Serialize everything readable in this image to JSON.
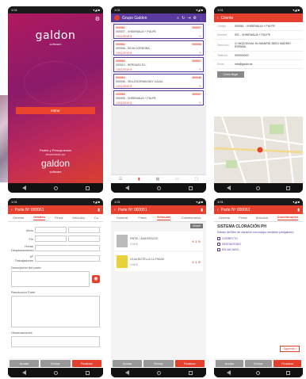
{
  "login": {
    "brand_top": "galdon",
    "brand_sub": "software",
    "login_button": "entrar",
    "footer_line1": "Partes y Presupuestos",
    "footer_line2": "desarrollado por",
    "brand_bottom": "galdon",
    "brand_bottom_sub": "software"
  },
  "list": {
    "header_title": "Grupo Galdon",
    "cards": [
      {
        "id": "000061",
        "code": "000007",
        "client": "000007 - VHIDENALIA + PULPE",
        "date": "13/11/2019 8"
      },
      {
        "id": "000062",
        "code": "000008",
        "client": "000008 - SILVA CORDOBA",
        "date": "13/11/2019 8"
      },
      {
        "id": "000063",
        "code": "000007",
        "client": "000010 - HERGAZU S.L.",
        "date": "13/11/2019 8"
      },
      {
        "id": "000064",
        "code": "000046",
        "client": "000046 - VELLEGORIAN BOY CAJAL",
        "date": "13/11/2019 8"
      },
      {
        "id": "000065",
        "code": "000007",
        "client": "000005 - VHIDENALIA + PULPE",
        "date": "13/11/2019 8"
      }
    ]
  },
  "client": {
    "header_title": "Cliente",
    "rows": [
      {
        "label": "Código",
        "value": "000061 - VHIDENALIA + PULPE"
      },
      {
        "label": "Nombre",
        "value": "001 - VHIDENALIA + PULPE"
      },
      {
        "label": "Dirección",
        "value": "C/ MOZODIVAL 50 /MADRID 28001 MADRID ESPAÑA"
      },
      {
        "label": "Teléfono",
        "value": "000000000"
      },
      {
        "label": "Email",
        "value": "info@galdn.es"
      }
    ],
    "map_button": "Cómo llegar"
  },
  "parte1": {
    "header_title": "Parte Nº 000061",
    "tabs": [
      "General",
      "Gestión",
      "Firma",
      "Artículos",
      "Cu"
    ],
    "active_tab": "Gestión",
    "labels": [
      "Inicio",
      "Fin",
      "Horas Desplazamiento",
      "Nº Trabajadores"
    ],
    "section_description": "Descripción del parte",
    "section_resolution": "Resolución Parte",
    "section_observations": "Observaciones",
    "buttons": [
      "Anular",
      "Enviar",
      "Finalizar"
    ]
  },
  "parte2": {
    "header_title": "Parte Nº 000061",
    "tabs": [
      "General",
      "Firma",
      "Artículos",
      "Cuestionarios"
    ],
    "active_tab": "Artículos",
    "add_label": "Añadir",
    "items": [
      {
        "name": "PAPEL / MADERA2CE",
        "price": "0.00 €",
        "qty": "1"
      },
      {
        "name": "LEJIA BOTELLA 1L/TRANS",
        "price": "0.00 €",
        "qty": "1"
      }
    ],
    "buttons": [
      "Anular",
      "Enviar",
      "Finalizar"
    ]
  },
  "parte3": {
    "header_title": "Parte Nº 000061",
    "tabs": [
      "General",
      "Firma",
      "Artículos",
      "Cuestionarios"
    ],
    "active_tab": "Cuestionarios",
    "q_title": "SISTEMA CLORACIÓN PH",
    "q_text": "Estado del filtro de cloración con equipo medición (obligatorio)",
    "options": [
      "CORRECTO",
      "DESGASTADO",
      "EN VACIADO"
    ],
    "next_label": "Siguiente",
    "buttons": [
      "Anular",
      "Enviar",
      "Finalizar"
    ]
  },
  "status": {
    "time": "1:01",
    "signal": "▾◢ ■"
  },
  "colors": {
    "accent": "#e53f2d",
    "card_border": "#5b3a9e"
  }
}
